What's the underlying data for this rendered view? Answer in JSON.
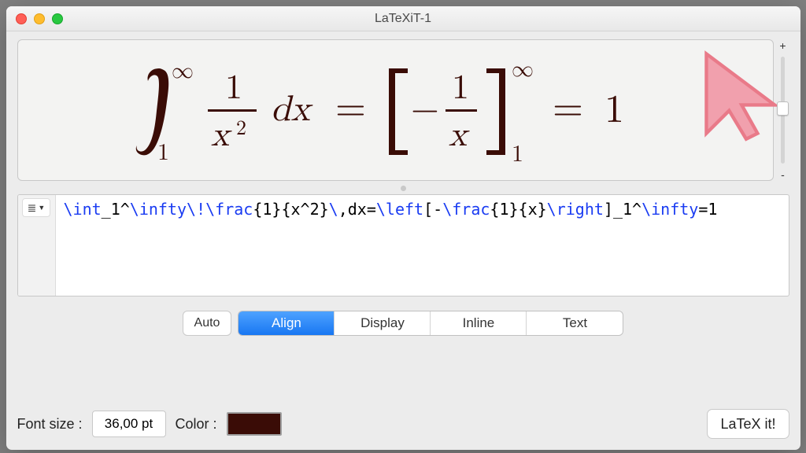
{
  "window": {
    "title": "LaTeXiT-1"
  },
  "latex_source": {
    "spans": [
      {
        "cls": "cmd",
        "t": "\\int"
      },
      {
        "cls": "txt",
        "t": "_1^"
      },
      {
        "cls": "cmd",
        "t": "\\infty\\!\\frac"
      },
      {
        "cls": "txt",
        "t": "{1}{x^2}"
      },
      {
        "cls": "cmd",
        "t": "\\"
      },
      {
        "cls": "txt",
        "t": ",dx="
      },
      {
        "cls": "cmd",
        "t": "\\left"
      },
      {
        "cls": "txt",
        "t": "[-"
      },
      {
        "cls": "cmd",
        "t": "\\frac"
      },
      {
        "cls": "txt",
        "t": "{1}{x}"
      },
      {
        "cls": "cmd",
        "t": "\\right"
      },
      {
        "cls": "txt",
        "t": "]_1^"
      },
      {
        "cls": "cmd",
        "t": "\\infty"
      },
      {
        "cls": "txt",
        "t": "=1"
      }
    ],
    "raw": "\\int_1^\\infty\\!\\frac{1}{x^2}\\,dx=\\left[-\\frac{1}{x}\\right]_1^\\infty=1"
  },
  "modes": {
    "auto": "Auto",
    "options": [
      "Align",
      "Display",
      "Inline",
      "Text"
    ],
    "selected": "Align"
  },
  "font": {
    "label": "Font size :",
    "value": "36,00 pt"
  },
  "color": {
    "label": "Color :",
    "value": "#3a0c06"
  },
  "action": {
    "latexit": "LaTeX it!"
  },
  "gutter": {
    "menu_glyph": "≣"
  },
  "zoom": {
    "plus": "+",
    "minus": "-"
  }
}
